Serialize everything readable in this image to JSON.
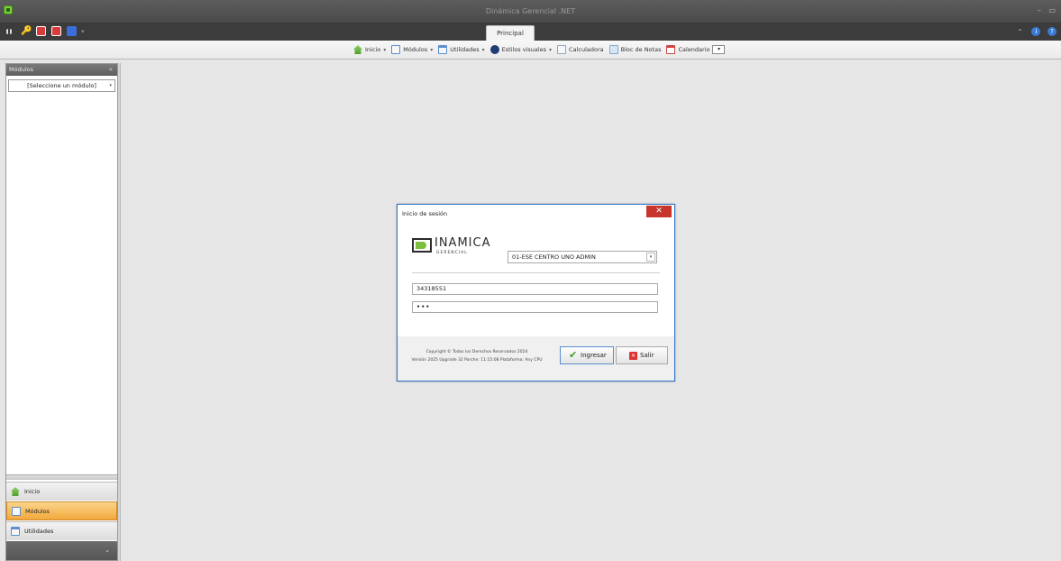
{
  "window": {
    "title": "Dinámica Gerencial .NET",
    "controls": [
      "–",
      "▭"
    ]
  },
  "quick_access": {
    "dropdown": "▾"
  },
  "tabs": [
    {
      "label": "Principal",
      "active": true
    }
  ],
  "ribbon": {
    "items": [
      {
        "label": "Inicio",
        "icon": "home-icon",
        "has_dropdown": true
      },
      {
        "label": "Módulos",
        "icon": "modules-icon",
        "has_dropdown": true
      },
      {
        "label": "Utilidades",
        "icon": "utilities-icon",
        "has_dropdown": true
      },
      {
        "label": "Estilos visuales",
        "icon": "visual-styles-icon",
        "has_dropdown": true
      },
      {
        "label": "Calculadora",
        "icon": "calculator-icon",
        "has_dropdown": false
      },
      {
        "label": "Bloc de Notas",
        "icon": "notepad-icon",
        "has_dropdown": false
      },
      {
        "label": "Calendario",
        "icon": "calendar-icon",
        "has_dropdown": true
      }
    ],
    "dropdown_glyph": "▾"
  },
  "left_panel": {
    "header": "Módulos",
    "collapse_glyph": "«",
    "module_select": "[Seleccione un módulo]",
    "nav": [
      {
        "label": "Inicio",
        "icon": "home-icon",
        "active": false
      },
      {
        "label": "Módulos",
        "icon": "modules-icon",
        "active": true
      },
      {
        "label": "Utilidades",
        "icon": "utilities-icon",
        "active": false
      }
    ],
    "footer_chevron": "⌄"
  },
  "login_dialog": {
    "title": "Inicio de sesión",
    "close_glyph": "✕",
    "logo_text": "INAMICA",
    "logo_subtext": "GERENCIAL",
    "company": "01-ESE CENTRO UNO ADMIN",
    "username": "34318551",
    "password_mask": "•••",
    "copyright": "Copyright © Todos los Derechos Reservados 2024",
    "version": "Versión 2025 Upgrade 32 Parche: 11:15:08 Plataforma: Any CPU",
    "login_button": "Ingresar",
    "exit_button": "Salir"
  },
  "colors": {
    "accent": "#2b6fc4",
    "active_nav": "#f2a93c",
    "close": "#c7352b",
    "logo_green": "#7cbf3c"
  }
}
